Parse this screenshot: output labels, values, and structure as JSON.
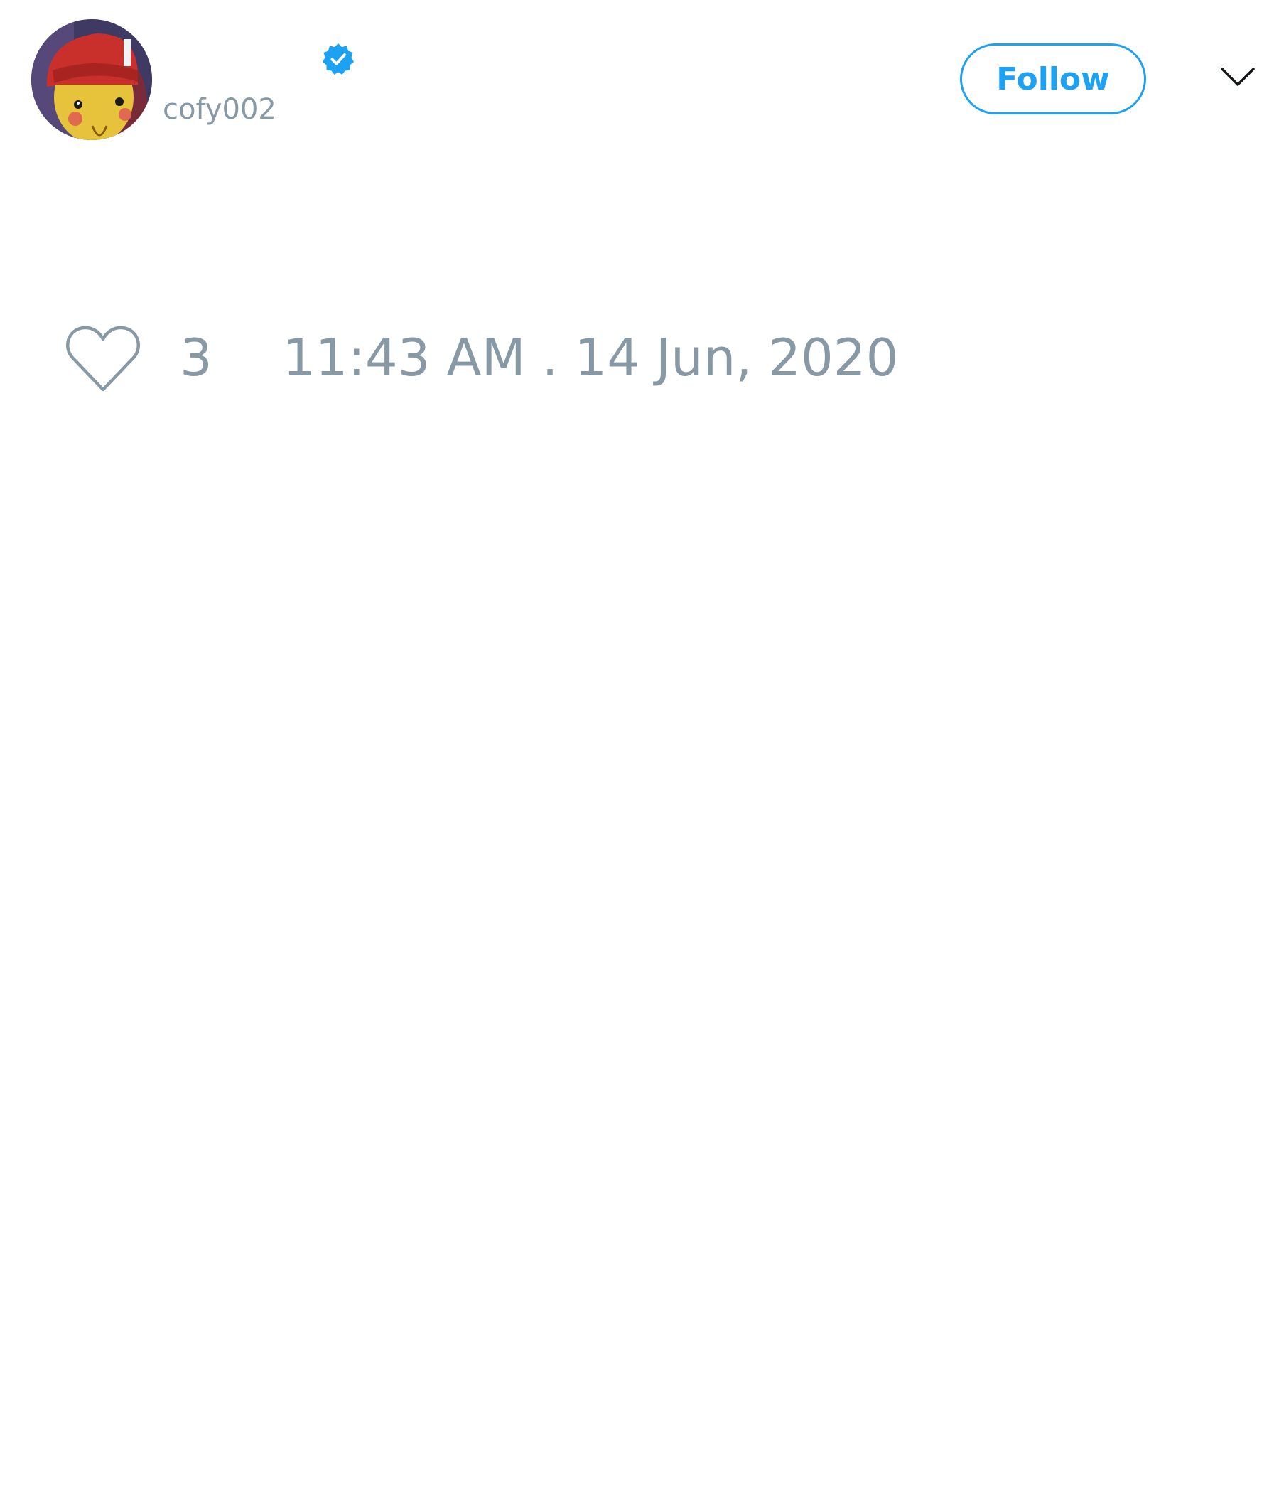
{
  "tweet": {
    "author": {
      "display_name": "",
      "handle": "cofy002",
      "verified": true,
      "avatar_icon": "avatar-image"
    },
    "follow_label": "Follow",
    "menu_icon": "chevron-down-icon",
    "like_icon": "heart-icon",
    "like_count": "3",
    "timestamp": "11:43 AM . 14 Jun, 2020"
  },
  "colors": {
    "accent": "#1da1f2",
    "muted_text": "#8899a6",
    "background": "#ffffff",
    "chevron": "#14171a"
  }
}
